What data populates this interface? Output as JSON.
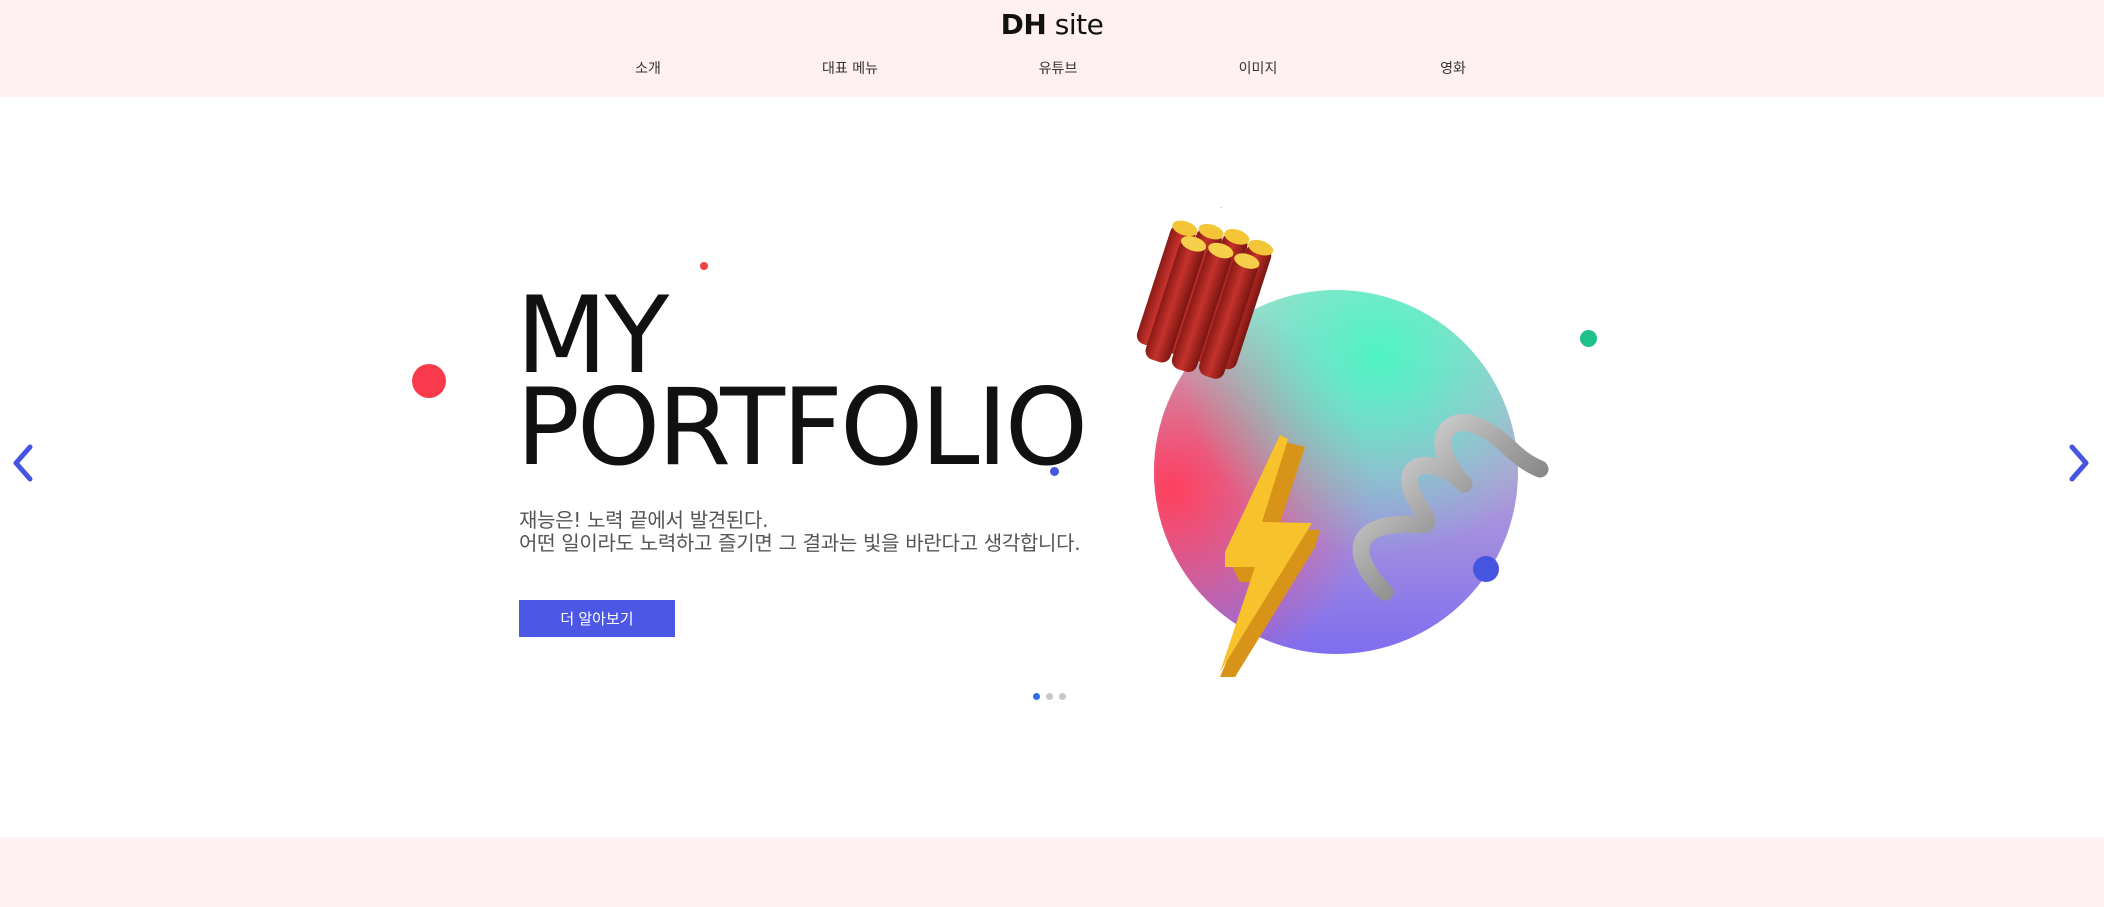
{
  "header": {
    "logo_bold": "DH",
    "logo_light": "site",
    "nav": [
      "소개",
      "대표 메뉴",
      "유튜브",
      "이미지",
      "영화"
    ]
  },
  "hero": {
    "title": "MY\nPORTFOLIO",
    "description": "재능은! 노력 끝에서 발견된다.\n어떤 일이라도 노력하고 즐기면 그 결과는 빛을 바란다고 생각합니다.",
    "cta_label": "더 알아보기",
    "slide_count": 3,
    "active_slide": 1
  },
  "icons": {
    "prev": "chevron-left-icon",
    "next": "chevron-right-icon",
    "dynamite": "dynamite-icon",
    "lightning": "lightning-icon",
    "spring": "spring-icon"
  },
  "colors": {
    "header_bg": "#fff1f1",
    "accent": "#4c57e6",
    "text": "#111111",
    "pager_active": "#2f6df0",
    "dot_red": "#f93a4d",
    "dot_green": "#1dc28a",
    "dot_blue": "#4655e0"
  }
}
